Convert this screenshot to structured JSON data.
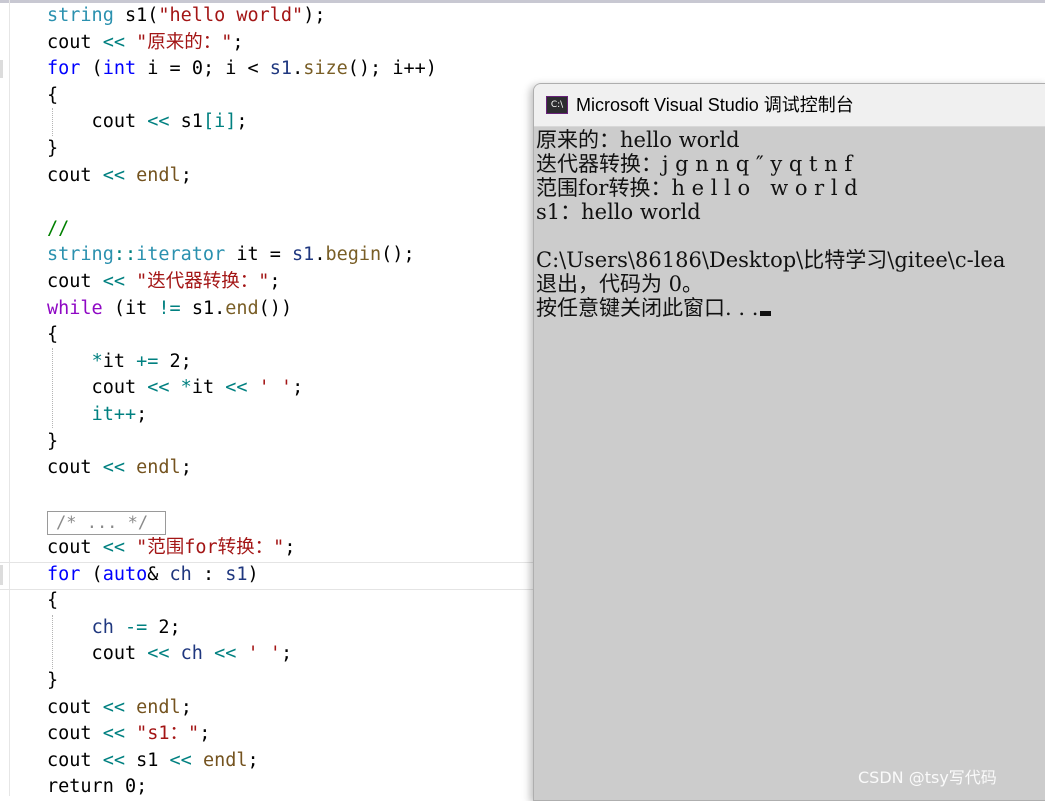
{
  "editor": {
    "lines": [
      {
        "t": [
          [
            "string",
            "ty"
          ],
          [
            " s1(",
            ""
          ],
          [
            "\"hello world\"",
            "str"
          ],
          [
            ");",
            ""
          ]
        ]
      },
      {
        "t": [
          [
            "cout ",
            ""
          ],
          [
            "<< ",
            "op"
          ],
          [
            "\"原来的：\"",
            "str"
          ],
          [
            ";",
            ""
          ]
        ]
      },
      {
        "t": [
          [
            "for",
            "kw"
          ],
          [
            " (",
            ""
          ],
          [
            "int",
            "kw"
          ],
          [
            " i = 0; i < ",
            ""
          ],
          [
            "s1",
            "var"
          ],
          [
            ".",
            ""
          ],
          [
            "size",
            "mem"
          ],
          [
            "(); i++)",
            ""
          ]
        ]
      },
      {
        "t": [
          [
            "{",
            ""
          ]
        ]
      },
      {
        "t": [
          [
            "    cout ",
            ""
          ],
          [
            "<< ",
            "op"
          ],
          [
            "s1",
            ""
          ],
          [
            "[i]",
            "op"
          ],
          [
            ";",
            ""
          ]
        ]
      },
      {
        "t": [
          [
            "}",
            ""
          ]
        ]
      },
      {
        "t": [
          [
            "cout ",
            ""
          ],
          [
            "<< ",
            "op"
          ],
          [
            "endl",
            "fn"
          ],
          [
            ";",
            ""
          ]
        ]
      },
      {
        "t": []
      },
      {
        "t": [
          [
            "//",
            "cm"
          ]
        ]
      },
      {
        "t": [
          [
            "string",
            "ty"
          ],
          [
            "::",
            "op"
          ],
          [
            "iterator",
            "ty"
          ],
          [
            " it = ",
            ""
          ],
          [
            "s1",
            "var"
          ],
          [
            ".",
            ""
          ],
          [
            "begin",
            "mem"
          ],
          [
            "();",
            ""
          ]
        ]
      },
      {
        "t": [
          [
            "cout ",
            ""
          ],
          [
            "<< ",
            "op"
          ],
          [
            "\"迭代器转换：\"",
            "str"
          ],
          [
            ";",
            ""
          ]
        ]
      },
      {
        "t": [
          [
            "while",
            "kw2"
          ],
          [
            " (it ",
            ""
          ],
          [
            "!=",
            "op"
          ],
          [
            " s1.",
            ""
          ],
          [
            "end",
            "mem"
          ],
          [
            "())",
            ""
          ]
        ]
      },
      {
        "t": [
          [
            "{",
            ""
          ]
        ]
      },
      {
        "t": [
          [
            "    ",
            ""
          ],
          [
            "*",
            "op"
          ],
          [
            "it ",
            ""
          ],
          [
            "+=",
            "op"
          ],
          [
            " 2;",
            ""
          ]
        ]
      },
      {
        "t": [
          [
            "    cout ",
            ""
          ],
          [
            "<< *",
            "op"
          ],
          [
            "it ",
            ""
          ],
          [
            "<< ",
            "op"
          ],
          [
            "' '",
            "str"
          ],
          [
            ";",
            ""
          ]
        ]
      },
      {
        "t": [
          [
            "    ",
            ""
          ],
          [
            "it++",
            "op"
          ],
          [
            ";",
            ""
          ]
        ]
      },
      {
        "t": [
          [
            "}",
            ""
          ]
        ]
      },
      {
        "t": [
          [
            "cout ",
            ""
          ],
          [
            "<< ",
            "op"
          ],
          [
            "endl",
            "fn"
          ],
          [
            ";",
            ""
          ]
        ]
      },
      {
        "t": []
      },
      {
        "t": []
      },
      {
        "t": [
          [
            "cout ",
            ""
          ],
          [
            "<< ",
            "op"
          ],
          [
            "\"范围for转换：\"",
            "str"
          ],
          [
            ";",
            ""
          ]
        ]
      },
      {
        "t": [
          [
            "for",
            "kw"
          ],
          [
            " (",
            ""
          ],
          [
            "auto",
            "kw"
          ],
          [
            "& ",
            ""
          ],
          [
            "ch",
            "var"
          ],
          [
            " : ",
            ""
          ],
          [
            "s1",
            "var"
          ],
          [
            ")",
            ""
          ]
        ]
      },
      {
        "t": [
          [
            "{",
            ""
          ]
        ]
      },
      {
        "t": [
          [
            "    ",
            ""
          ],
          [
            "ch",
            "var"
          ],
          [
            " ",
            ""
          ],
          [
            "-=",
            "op"
          ],
          [
            " 2;",
            ""
          ]
        ]
      },
      {
        "t": [
          [
            "    cout ",
            ""
          ],
          [
            "<< ",
            "op"
          ],
          [
            "ch",
            "var"
          ],
          [
            " ",
            ""
          ],
          [
            "<< ",
            "op"
          ],
          [
            "' '",
            "str"
          ],
          [
            ";",
            ""
          ]
        ]
      },
      {
        "t": [
          [
            "}",
            ""
          ]
        ]
      },
      {
        "t": [
          [
            "cout ",
            ""
          ],
          [
            "<< ",
            "op"
          ],
          [
            "endl",
            "fn"
          ],
          [
            ";",
            ""
          ]
        ]
      },
      {
        "t": [
          [
            "cout ",
            ""
          ],
          [
            "<< ",
            "op"
          ],
          [
            "\"s1：\"",
            "str"
          ],
          [
            ";",
            ""
          ]
        ]
      },
      {
        "t": [
          [
            "cout ",
            ""
          ],
          [
            "<< ",
            "op"
          ],
          [
            "s1 ",
            ""
          ],
          [
            "<< ",
            "op"
          ],
          [
            "endl",
            "fn"
          ],
          [
            ";",
            ""
          ]
        ]
      },
      {
        "t": [
          [
            "return",
            ""
          ],
          [
            " 0;",
            ""
          ]
        ]
      }
    ],
    "folded_comment": "/* ... */"
  },
  "console": {
    "title": "Microsoft Visual Studio 调试控制台",
    "icon_label": "C:\\",
    "lines": [
      "原来的：hello world",
      "迭代器转换：j g n n q ″ y q t n f",
      "范围for转换：h e l l o   w o r l d",
      "s1：hello world",
      "",
      "C:\\Users\\86186\\Desktop\\比特学习\\gitee\\c-lea",
      "退出，代码为 0。",
      "按任意键关闭此窗口. . ."
    ]
  },
  "watermark": "CSDN @tsy写代码"
}
